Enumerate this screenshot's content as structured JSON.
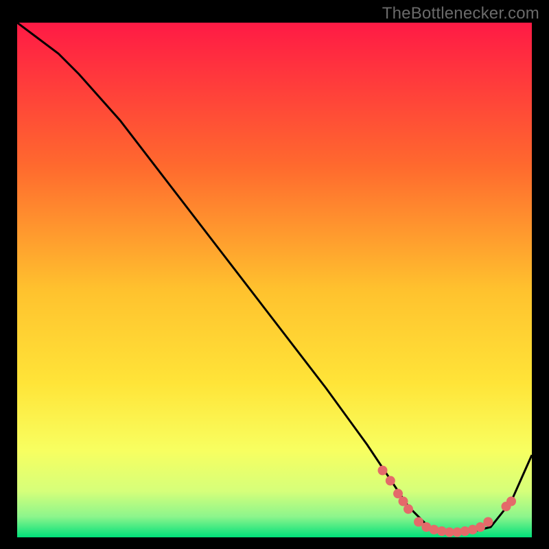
{
  "watermark": "TheBottlenecker.com",
  "chart_data": {
    "type": "line",
    "title": "",
    "xlabel": "",
    "ylabel": "",
    "xlim": [
      0,
      100
    ],
    "ylim": [
      0,
      100
    ],
    "grid": false,
    "background_gradient": {
      "top": "#ff1a45",
      "mid_upper": "#ff8a2e",
      "mid": "#ffe438",
      "mid_lower": "#f4ff66",
      "lower": "#b9ff8a",
      "bottom": "#00e07a"
    },
    "series": [
      {
        "name": "curve",
        "stroke": "#000000",
        "x": [
          0,
          4,
          8,
          12,
          20,
          30,
          40,
          50,
          60,
          68,
          72,
          76,
          80,
          84,
          88,
          92,
          96,
          100
        ],
        "y": [
          100,
          97,
          94,
          90,
          81,
          68,
          55,
          42,
          29,
          18,
          12,
          6,
          2,
          1,
          1,
          2,
          7,
          16
        ]
      }
    ],
    "highlight_points": {
      "name": "dots",
      "fill": "#e46a6a",
      "points": [
        {
          "x": 71,
          "y": 13
        },
        {
          "x": 72.5,
          "y": 11
        },
        {
          "x": 74,
          "y": 8.5
        },
        {
          "x": 75,
          "y": 7
        },
        {
          "x": 76,
          "y": 5.5
        },
        {
          "x": 78,
          "y": 3
        },
        {
          "x": 79.5,
          "y": 2
        },
        {
          "x": 81,
          "y": 1.5
        },
        {
          "x": 82.5,
          "y": 1.2
        },
        {
          "x": 84,
          "y": 1
        },
        {
          "x": 85.5,
          "y": 1
        },
        {
          "x": 87,
          "y": 1.2
        },
        {
          "x": 88.5,
          "y": 1.5
        },
        {
          "x": 90,
          "y": 2
        },
        {
          "x": 91.5,
          "y": 3
        },
        {
          "x": 95,
          "y": 6
        },
        {
          "x": 96,
          "y": 7
        }
      ]
    }
  }
}
